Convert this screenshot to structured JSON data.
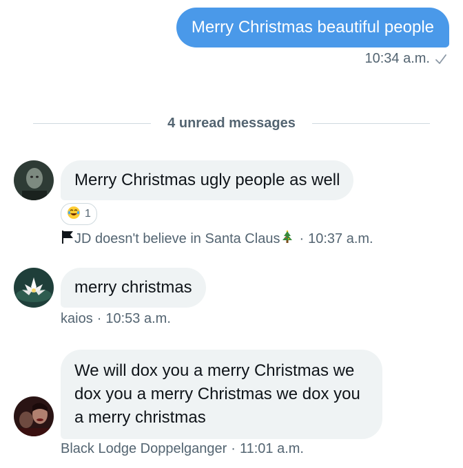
{
  "sent_message": {
    "text": "Merry Christmas beautiful people",
    "time": "10:34 a.m.",
    "status_icon": "check-icon"
  },
  "divider": {
    "label": "4 unread messages"
  },
  "messages": [
    {
      "sender": "JD doesn't believe in Santa Claus",
      "sender_prefix_icon": "black-flag-icon",
      "sender_suffix_icon": "christmas-tree-icon",
      "text": "Merry Christmas ugly people as well",
      "time": "10:37 a.m.",
      "reaction": {
        "icon": "face-with-tears-of-joy-icon",
        "count": "1"
      }
    },
    {
      "sender": "kaios",
      "text": "merry christmas",
      "time": "10:53 a.m."
    },
    {
      "sender": "Black Lodge Doppelganger",
      "text": "We will dox you a merry Christmas we dox you a merry Christmas we dox you a merry christmas",
      "time": "11:01 a.m."
    }
  ],
  "separator": "·",
  "colors": {
    "sent_bubble": "#4a99e9",
    "received_bubble": "#eff3f4",
    "meta_text": "#536471"
  }
}
